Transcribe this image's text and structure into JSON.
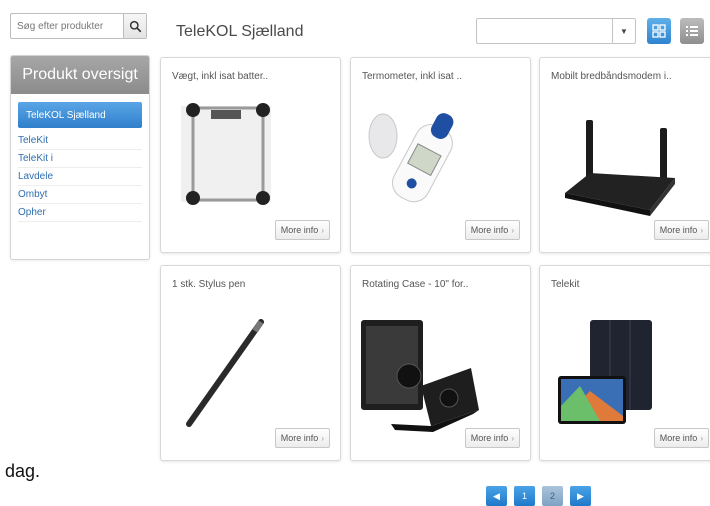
{
  "search": {
    "placeholder": "Søg efter produkter"
  },
  "sidebar": {
    "title": "Produkt oversigt",
    "active_item": "TeleKOL Sjælland",
    "items": [
      {
        "label": "TeleKit"
      },
      {
        "label": "TeleKit i"
      },
      {
        "label": "Lavdele"
      },
      {
        "label": "Ombyt"
      },
      {
        "label": "Opher"
      }
    ]
  },
  "header": {
    "title": "TeleKOL Sjælland"
  },
  "sort_dropdown": {
    "value": ""
  },
  "products": [
    {
      "name": "Vægt, inkl isat batter..",
      "more": "More info"
    },
    {
      "name": "Termometer, inkl isat ..",
      "more": "More info"
    },
    {
      "name": "Mobilt bredbåndsmodem i..",
      "more": "More info"
    },
    {
      "name": "1 stk. Stylus pen",
      "more": "More info"
    },
    {
      "name": "Rotating Case - 10\" for..",
      "more": "More info"
    },
    {
      "name": "Telekit",
      "more": "More info"
    }
  ],
  "pagination": {
    "pages": [
      "1",
      "2"
    ],
    "current": "2"
  },
  "fragment_text": "l dag.",
  "colors": {
    "accent": "#2f84d0",
    "sidebar_header": "#9a9a9a",
    "link": "#2f6fb0"
  }
}
